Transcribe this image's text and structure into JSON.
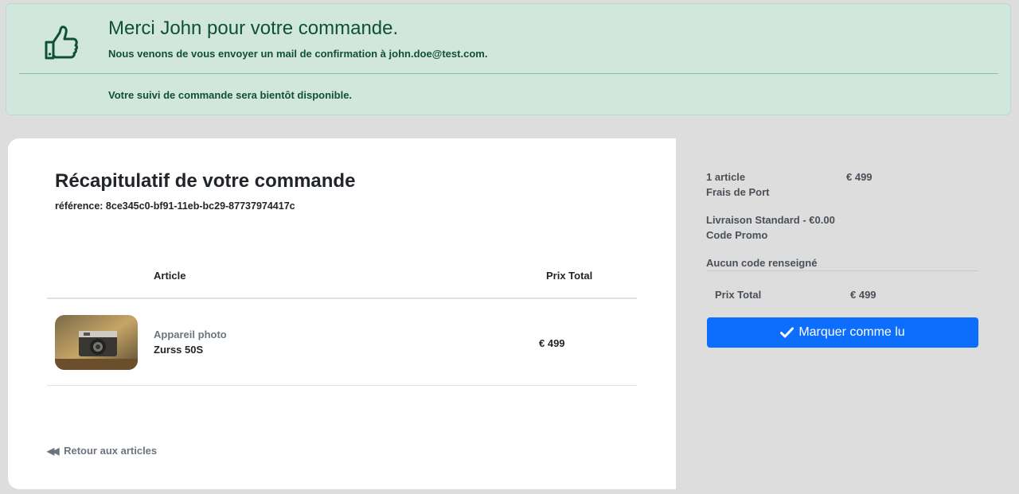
{
  "alert": {
    "title": "Merci John pour votre commande.",
    "confirmation": "Nous venons de vous envoyer un mail de confirmation à john.doe@test.com.",
    "tracking": "Votre suivi de commande sera bientôt disponible.",
    "icon": "thumbs-up-icon"
  },
  "order": {
    "title": "Récapitulatif de votre commande",
    "reference": "référence: 8ce345c0-bf91-11eb-bc29-87737974417c",
    "columns": {
      "article": "Article",
      "total": "Prix Total"
    },
    "items": [
      {
        "category": "Appareil photo",
        "name": "Zurss 50S",
        "price": "€ 499"
      }
    ],
    "back_label": "Retour aux articles"
  },
  "summary": {
    "items_label": "1 article",
    "items_value": "€ 499",
    "shipping_label": "Frais de Port",
    "shipping_method": "Livraison Standard - €0.00",
    "promo_label": "Code Promo",
    "promo_value": "Aucun code renseigné",
    "total_label": "Prix Total",
    "total_value": "€ 499",
    "button_label": "Marquer comme lu"
  },
  "colors": {
    "alert_bg": "#d1e7dd",
    "alert_text": "#0f5132",
    "primary": "#0d6efd",
    "page_bg": "#dddddd"
  }
}
